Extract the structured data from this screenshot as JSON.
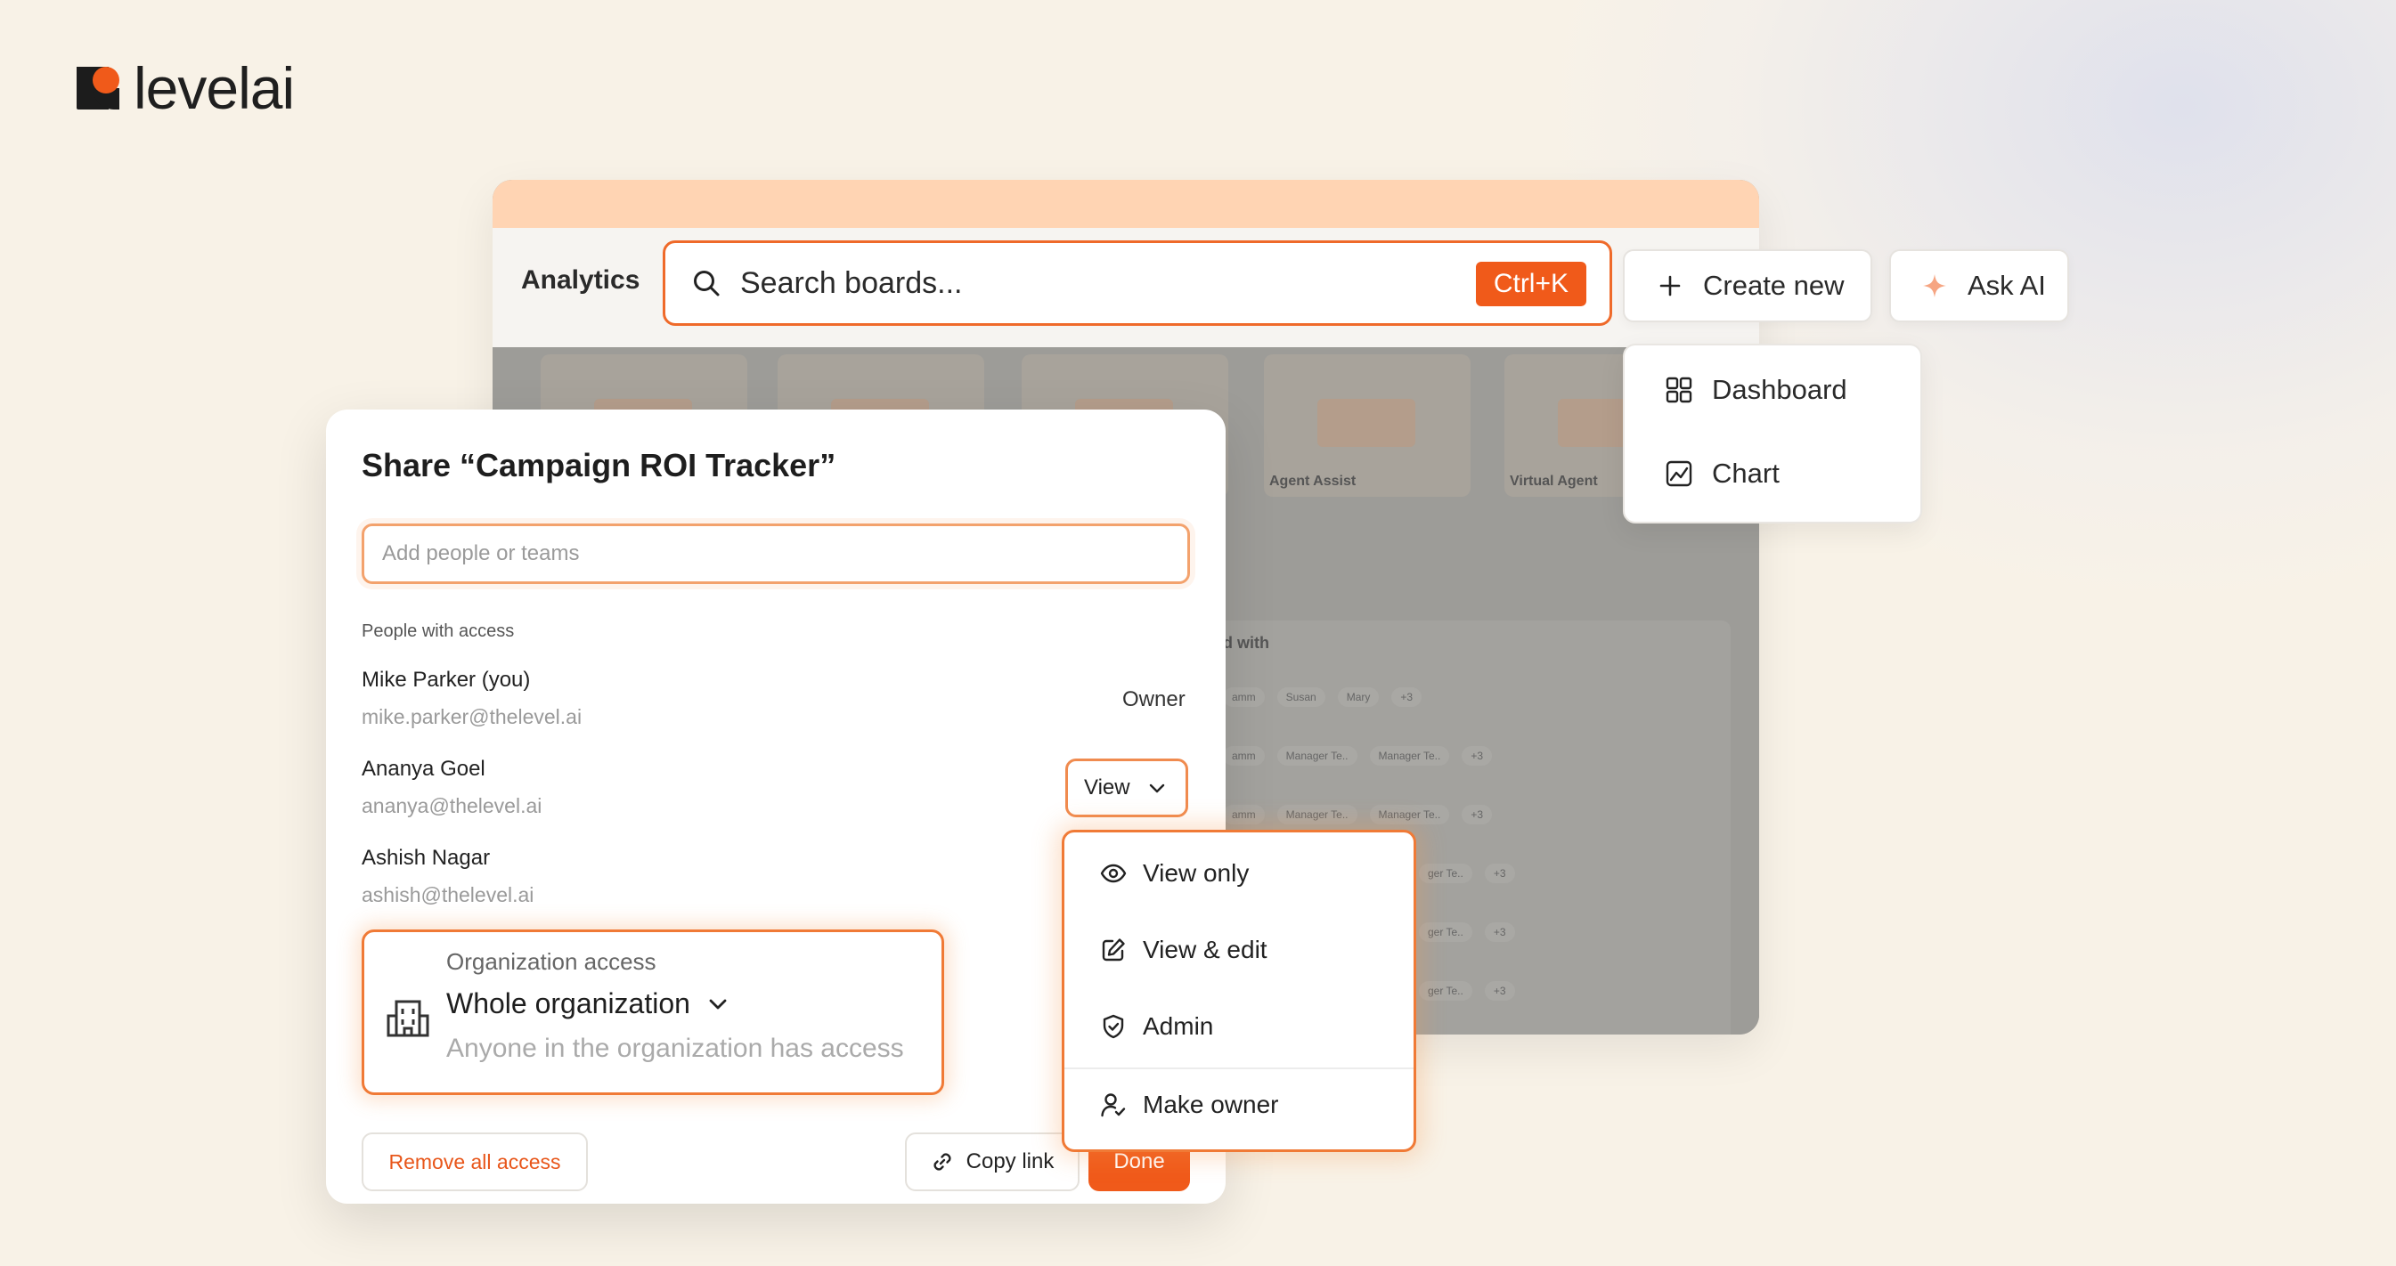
{
  "brand": {
    "name": "levelai"
  },
  "app": {
    "title": "Analytics",
    "board_labels": [
      "Agent Assist",
      "Virtual Agent"
    ],
    "table_header": "d with",
    "table_rows": [
      [
        "amm",
        "Susan",
        "Mary",
        "+3"
      ],
      [
        "amm",
        "Manager Te..",
        "Manager Te..",
        "+3"
      ],
      [
        "amm",
        "Manager Te..",
        "Manager Te..",
        "+3"
      ],
      [
        "ger Te..",
        "+3"
      ],
      [
        "ger Te..",
        "+3"
      ],
      [
        "ger Te..",
        "+3"
      ]
    ]
  },
  "search": {
    "placeholder": "Search boards...",
    "shortcut": "Ctrl+K"
  },
  "header_buttons": {
    "create_new": "Create new",
    "ask_ai": "Ask AI"
  },
  "create_menu": {
    "items": [
      "Dashboard",
      "Chart"
    ]
  },
  "share_dialog": {
    "title": "Share “Campaign ROI Tracker”",
    "input_placeholder": "Add people or teams",
    "section_label": "People with access",
    "people": [
      {
        "name": "Mike Parker (you)",
        "email": "mike.parker@thelevel.ai",
        "role": "Owner"
      },
      {
        "name": "Ananya Goel",
        "email": "ananya@thelevel.ai",
        "role": "View"
      },
      {
        "name": "Ashish Nagar",
        "email": "ashish@thelevel.ai"
      }
    ],
    "org_access": {
      "label": "Organization access",
      "value": "Whole organization",
      "description": "Anyone in the organization has access"
    },
    "buttons": {
      "remove_all": "Remove all access",
      "copy_link": "Copy link",
      "done": "Done"
    }
  },
  "permission_menu": {
    "items": [
      "View only",
      "View & edit",
      "Admin",
      "Make owner"
    ]
  },
  "colors": {
    "accent": "#f05a1a",
    "highlight_border": "#f07a36",
    "title_bar": "#ffd4b3",
    "background": "#f8f2e7"
  },
  "icons": {
    "search": "search-icon",
    "plus": "plus-icon",
    "sparkle": "sparkle-icon",
    "dashboard": "grid-icon",
    "chart": "chart-icon",
    "chevron": "chevron-down-icon",
    "building": "building-icon",
    "link": "link-icon",
    "eye": "eye-icon",
    "edit": "edit-icon",
    "shield": "shield-icon",
    "user_check": "user-check-icon"
  }
}
